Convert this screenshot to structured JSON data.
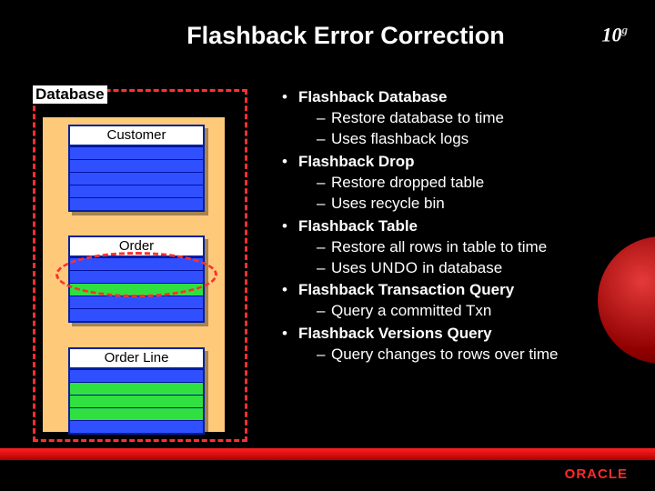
{
  "title": "Flashback Error Correction",
  "brand_top": "10",
  "brand_top_sup": "g",
  "brand_bottom": "ORACLE",
  "diagram": {
    "frame_label": "Database",
    "tables": [
      {
        "name": "Customer"
      },
      {
        "name": "Order"
      },
      {
        "name": "Order Line"
      }
    ]
  },
  "bullets": [
    {
      "head": "Flashback Database",
      "subs": [
        "Restore database to time",
        "Uses flashback logs"
      ]
    },
    {
      "head": "Flashback Drop",
      "subs": [
        "Restore dropped table",
        "Uses recycle bin"
      ]
    },
    {
      "head": "Flashback Table",
      "subs": [
        "Restore all rows in table to time",
        "Uses UNDO in database"
      ]
    },
    {
      "head": "Flashback Transaction Query",
      "subs": [
        "Query a committed Txn"
      ]
    },
    {
      "head": "Flashback Versions Query",
      "subs": [
        "Query changes to rows over time"
      ]
    }
  ]
}
